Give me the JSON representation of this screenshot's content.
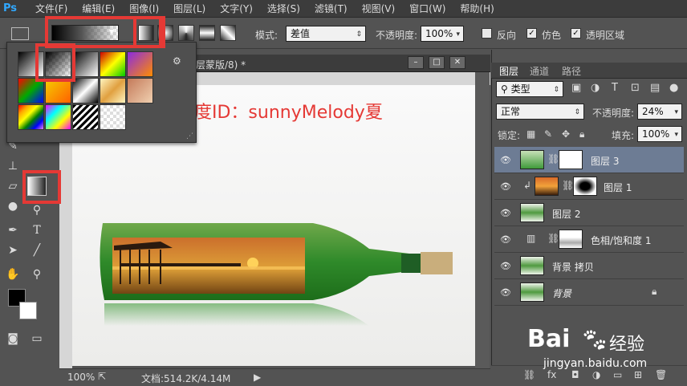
{
  "app": {
    "logo": "Ps"
  },
  "menu": [
    "文件(F)",
    "编辑(E)",
    "图像(I)",
    "图层(L)",
    "文字(Y)",
    "选择(S)",
    "滤镜(T)",
    "视图(V)",
    "窗口(W)",
    "帮助(H)"
  ],
  "options": {
    "mode_label": "模式:",
    "mode_value": "差值",
    "opacity_label": "不透明度:",
    "opacity_value": "100%",
    "reverse_label": "反向",
    "dither_label": "仿色",
    "transparency_label": "透明区域"
  },
  "document": {
    "title": "层蒙版/8) *",
    "zoom": "100%",
    "doc_info": "文档:514.2K/4.14M"
  },
  "panels": {
    "tabs": [
      "图层",
      "通道",
      "路径"
    ],
    "filter_kind": "类型",
    "blend_mode": "正常",
    "opacity_label": "不透明度:",
    "opacity_value": "24%",
    "lock_label": "锁定:",
    "fill_label": "填充:",
    "fill_value": "100%"
  },
  "layers": [
    {
      "name": "图层 3",
      "selected": true
    },
    {
      "name": "图层 1",
      "selected": false
    },
    {
      "name": "图层 2",
      "selected": false
    },
    {
      "name": "色相/饱和度 1",
      "selected": false
    },
    {
      "name": "背景 拷贝",
      "selected": false
    },
    {
      "name": "背景",
      "selected": false
    }
  ],
  "overlay_text": "百度ID：sunnyMelody夏",
  "watermark": {
    "brand": "Bai",
    "brand2": "经验",
    "url": "jingyan.baidu.com"
  },
  "colors": {
    "accent_red": "#e53935",
    "selection": "#6d7c94",
    "ps_blue": "#31a8ff"
  }
}
